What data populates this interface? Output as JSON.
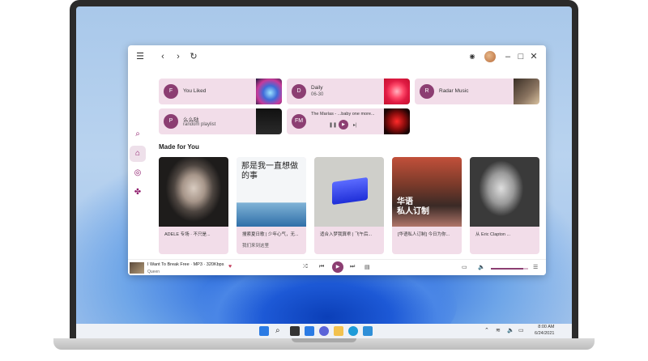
{
  "tiles": [
    {
      "letter": "F",
      "title": "You Liked",
      "subtitle": ""
    },
    {
      "letter": "D",
      "title": "Daily",
      "subtitle": "06-30"
    },
    {
      "letter": "R",
      "title": "Radar Music",
      "subtitle": ""
    },
    {
      "letter": "P",
      "title": "么么哒",
      "subtitle": "random playlist"
    },
    {
      "letter": "FM",
      "title": "The Marías - ...baby one more...",
      "subtitle": ""
    }
  ],
  "section_title": "Made for You",
  "cards": [
    {
      "caption": "ADELE 专场 · 不只是...",
      "caption2": ""
    },
    {
      "caption": "搜索夏日歌 | 少年心气，无...",
      "caption2": "我们来到这里"
    },
    {
      "caption": "适合入梦我算乖 | 飞午后...",
      "caption2": ""
    },
    {
      "caption": "[华语私人订制] 今日为你...",
      "caption2": ""
    },
    {
      "caption": "从 Eric Clapton ...",
      "caption2": ""
    }
  ],
  "cover_text": {
    "calligraphy": "那是我一直想做的事",
    "chinese": "华语\n私人订制"
  },
  "player": {
    "title": "I Want To Break Free",
    "format": "MP3",
    "bitrate": "320Kbps",
    "artist": "Queen",
    "volume": 0.87
  },
  "clock": {
    "time": "8:00 AM",
    "date": "6/24/2021"
  },
  "icons": {
    "menu": "menu-icon",
    "back": "back-icon",
    "forward": "forward-icon",
    "refresh": "refresh-icon",
    "accent": "#8c3e72",
    "tile_bg": "#f2dde9"
  }
}
